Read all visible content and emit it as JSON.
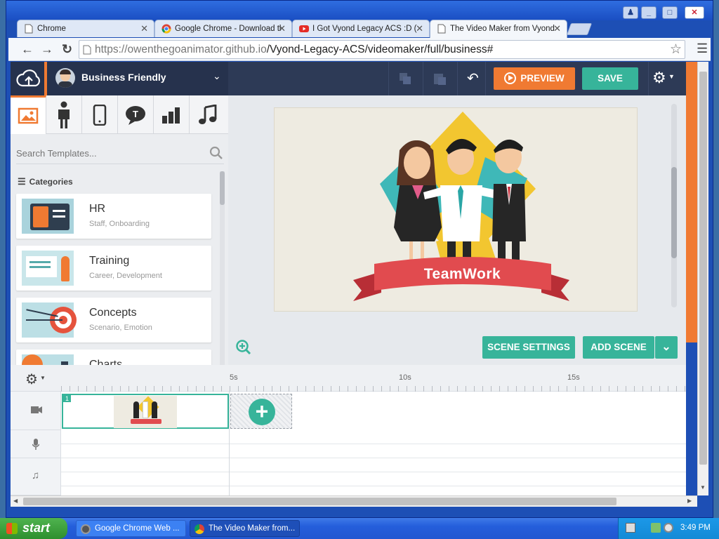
{
  "browser": {
    "tabs": [
      {
        "label": "Chrome",
        "icon": "page-icon"
      },
      {
        "label": "Google Chrome - Download tl",
        "icon": "chrome-icon"
      },
      {
        "label": "I Got Vyond Legacy ACS :D (",
        "icon": "youtube-icon"
      },
      {
        "label": "The Video Maker from Vyond",
        "icon": "page-icon",
        "active": true
      }
    ],
    "url_domain": "https://owenthegoanimator.github.io",
    "url_path": "/Vyond-Legacy-ACS/videomaker/full/business#"
  },
  "app": {
    "theme_name": "Business Friendly",
    "preview_label": "PREVIEW",
    "save_label": "SAVE",
    "search_placeholder": "Search Templates...",
    "categories_label": "Categories",
    "categories": [
      {
        "title": "HR",
        "subtitle": "Staff, Onboarding"
      },
      {
        "title": "Training",
        "subtitle": "Career, Development"
      },
      {
        "title": "Concepts",
        "subtitle": "Scenario, Emotion"
      },
      {
        "title": "Charts",
        "subtitle": ""
      }
    ],
    "scene_banner": "TeamWork",
    "scene_settings_label": "SCENE SETTINGS",
    "add_scene_label": "ADD SCENE",
    "timeline_marks": [
      "5s",
      "10s",
      "15s"
    ],
    "scene_number": "1"
  },
  "colors": {
    "accent_orange": "#f07a32",
    "accent_teal": "#37b49a",
    "topbar": "#2d3a56"
  },
  "taskbar": {
    "start_label": "start",
    "items": [
      {
        "label": "Google Chrome Web ..."
      },
      {
        "label": "The Video Maker from..."
      }
    ],
    "clock": "3:49 PM"
  }
}
